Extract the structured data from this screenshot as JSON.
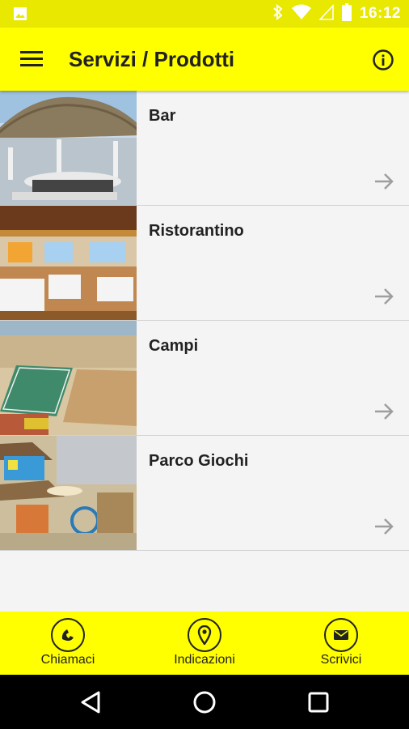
{
  "status_bar": {
    "time": "16:12",
    "icons": [
      "image-icon",
      "bluetooth-icon",
      "wifi-icon",
      "signal-icon",
      "battery-icon"
    ]
  },
  "app_bar": {
    "title": "Servizi / Prodotti",
    "menu_icon": "hamburger-menu-icon",
    "info_icon": "info-icon"
  },
  "list": {
    "items": [
      {
        "label": "Bar",
        "thumbnail": "bar-photo",
        "icon": "arrow-right-icon"
      },
      {
        "label": "Ristorantino",
        "thumbnail": "restaurant-photo",
        "icon": "arrow-right-icon"
      },
      {
        "label": "Campi",
        "thumbnail": "beach-courts-photo",
        "icon": "arrow-right-icon"
      },
      {
        "label": "Parco Giochi",
        "thumbnail": "playground-photo",
        "icon": "arrow-right-icon"
      }
    ]
  },
  "bottom_bar": {
    "buttons": [
      {
        "label": "Chiamaci",
        "icon": "phone-icon"
      },
      {
        "label": "Indicazioni",
        "icon": "location-pin-icon"
      },
      {
        "label": "Scrivici",
        "icon": "mail-icon"
      }
    ]
  },
  "nav_bar": {
    "icons": [
      "back-icon",
      "home-icon",
      "recents-icon"
    ]
  },
  "colors": {
    "accent": "#ffff00",
    "status_bar": "#e8e800",
    "text": "#222222",
    "list_background": "#f4f4f4",
    "divider": "#d2d2d2",
    "arrow": "#9e9e9e"
  }
}
